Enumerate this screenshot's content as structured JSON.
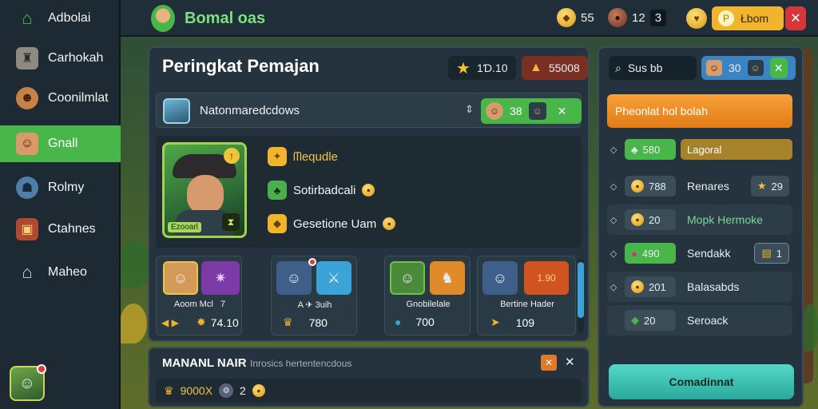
{
  "sidebar": {
    "items": [
      {
        "label": "Adbolai",
        "icon": "home-icon"
      },
      {
        "label": "Carhokah",
        "icon": "castle-icon"
      },
      {
        "label": "Coonilmlat",
        "icon": "creature-icon"
      },
      {
        "label": "Gnall",
        "icon": "hero-icon"
      },
      {
        "label": "Rolmy",
        "icon": "mask-icon"
      },
      {
        "label": "Ctahnes",
        "icon": "chest-icon"
      },
      {
        "label": "Maheo",
        "icon": "house-icon"
      }
    ]
  },
  "topbar": {
    "title": "Bomal oas",
    "res1": "55",
    "res2": "12",
    "res2_count": "3",
    "premium_label": "Łbom"
  },
  "panel": {
    "title": "Peringkat Pemajan",
    "stat1": "1Ɗ.10",
    "stat2": "55008",
    "player_name": "Natonmaredcdows",
    "player_score": "38",
    "features": [
      "ᗰequdle",
      "Sotirbadcali",
      "Gesetione Uam"
    ],
    "hero_tag": "Ezooarl",
    "cards": [
      {
        "label": "Aoom Mcl",
        "label2": "7",
        "value": "74.10"
      },
      {
        "label": "A ✈ 3uih",
        "value": "780"
      },
      {
        "label": "Gnobilelale",
        "value": "700"
      },
      {
        "label": "Bertine Hader",
        "value": "109"
      }
    ],
    "card_thumb_value": "1.90"
  },
  "bottom": {
    "title": "MANANL NAIR",
    "subtitle": "Inrosics hertentencdous",
    "value": "9000X",
    "extra": "2"
  },
  "right": {
    "search": "Sus bb",
    "count": "30",
    "orange": "Pheonlat hol bolah",
    "rows": [
      {
        "value": "580",
        "label": "Lagoral"
      },
      {
        "value": "788",
        "label": "Renares",
        "extra": "29"
      },
      {
        "value": "20",
        "label": "Mopk Hermoke"
      },
      {
        "value": "490",
        "label": "Sendakk",
        "extra": "1"
      },
      {
        "value": "201",
        "label": "Balasabds"
      },
      {
        "value": "20",
        "label": "Seroack"
      }
    ],
    "cta": "Comadinnat"
  }
}
